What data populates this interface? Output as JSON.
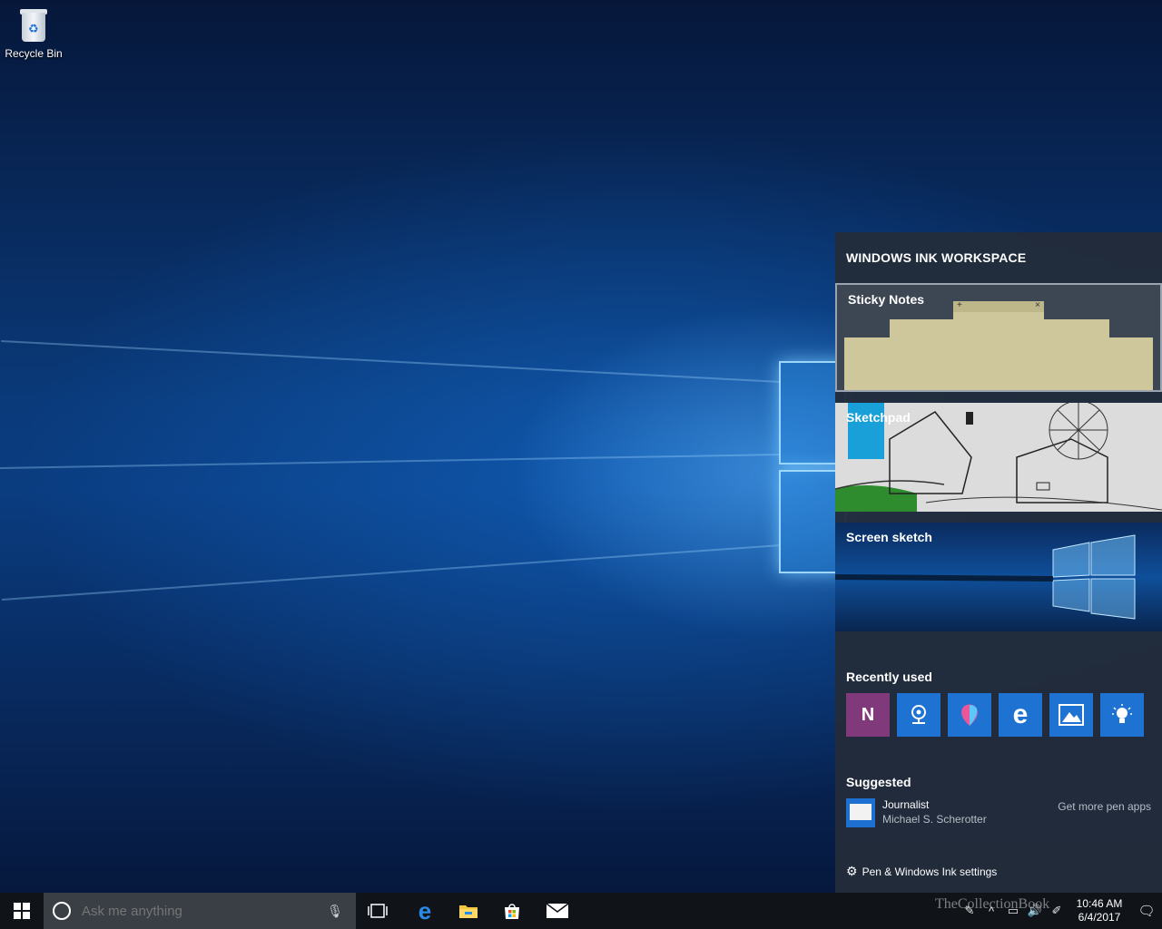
{
  "desktop": {
    "icons": [
      {
        "label": "Recycle Bin",
        "icon": "recycle-bin-icon"
      }
    ]
  },
  "ink_workspace": {
    "title": "WINDOWS INK WORKSPACE",
    "tiles": [
      {
        "label": "Sticky Notes"
      },
      {
        "label": "Sketchpad"
      },
      {
        "label": "Screen sketch"
      }
    ],
    "recently_used_label": "Recently used",
    "recent_apps": [
      {
        "icon": "onenote-icon",
        "color": "#80397b"
      },
      {
        "icon": "maps-icon",
        "color": "#1e73d2"
      },
      {
        "icon": "paint-3d-icon",
        "color": "#1e73d2"
      },
      {
        "icon": "edge-icon",
        "color": "#1e73d2"
      },
      {
        "icon": "photos-icon",
        "color": "#1e73d2"
      },
      {
        "icon": "tips-icon",
        "color": "#1e73d2"
      }
    ],
    "suggested_label": "Suggested",
    "suggested": {
      "name": "Journalist",
      "author": "Michael S. Scherotter"
    },
    "get_more": "Get more pen apps",
    "settings_label": "Pen & Windows Ink settings"
  },
  "taskbar": {
    "search_placeholder": "Ask me anything",
    "pinned": [
      "task-view-icon",
      "edge-icon",
      "file-explorer-icon",
      "store-icon",
      "mail-icon"
    ],
    "time": "10:46 AM",
    "date": "6/4/2017"
  },
  "watermark": "TheCollectionBook"
}
